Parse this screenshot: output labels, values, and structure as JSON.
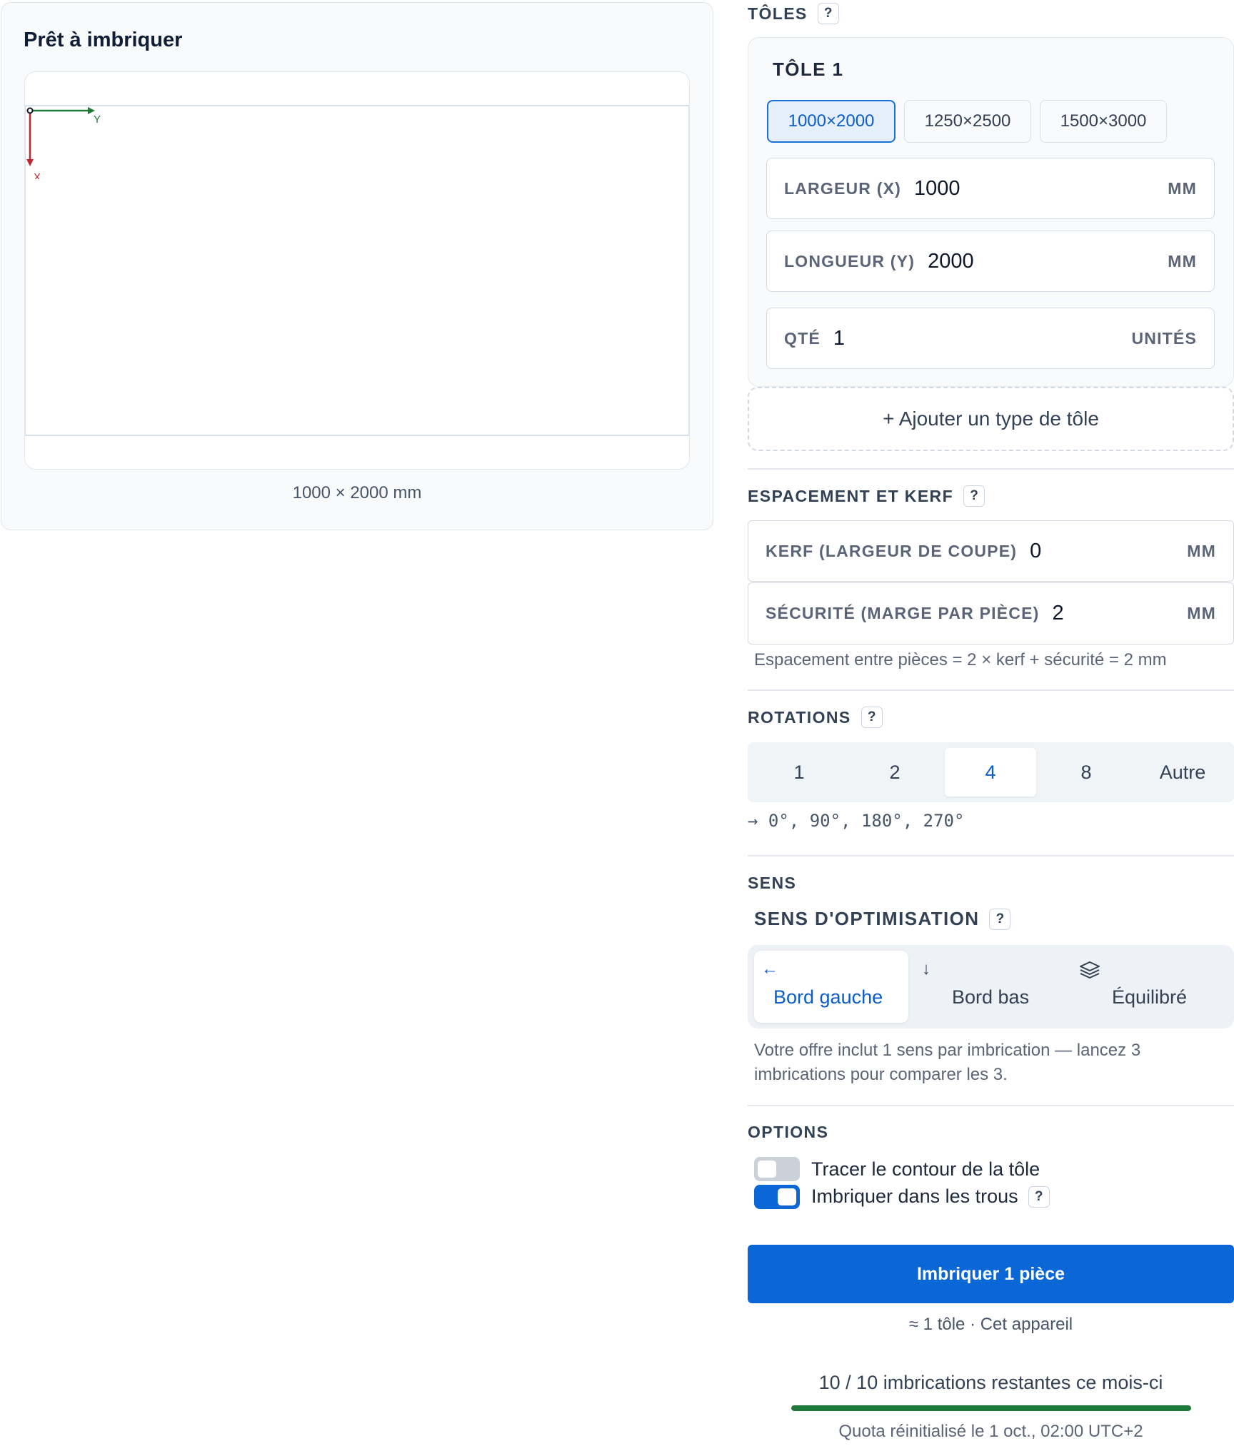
{
  "preview": {
    "title": "Prêt à imbriquer",
    "axis_x": "X",
    "axis_y": "Y",
    "dims": "1000 × 2000 mm"
  },
  "sheets": {
    "heading": "TÔLES",
    "help": "?",
    "card_title": "TÔLE 1",
    "presets": [
      "1000×2000",
      "1250×2500",
      "1500×3000"
    ],
    "active_preset": "1000×2000",
    "width": {
      "label": "LARGEUR (X)",
      "value": "1000",
      "unit": "MM"
    },
    "length": {
      "label": "LONGUEUR (Y)",
      "value": "2000",
      "unit": "MM"
    },
    "qty": {
      "label": "QTÉ",
      "value": "1",
      "unit": "UNITÉS"
    },
    "add_label": "+ Ajouter un type de tôle"
  },
  "spacing": {
    "heading": "ESPACEMENT ET KERF",
    "help": "?",
    "kerf": {
      "label": "KERF (LARGEUR DE COUPE)",
      "value": "0",
      "unit": "MM"
    },
    "safety": {
      "label": "SÉCURITÉ (MARGE PAR PIÈCE)",
      "value": "2",
      "unit": "MM"
    },
    "formula": "Espacement entre pièces = 2 × kerf + sécurité = 2 mm"
  },
  "rotations": {
    "heading": "ROTATIONS",
    "help": "?",
    "options": [
      "1",
      "2",
      "4",
      "8",
      "Autre"
    ],
    "active": "4",
    "note": "→ 0°, 90°, 180°, 270°"
  },
  "direction": {
    "heading": "SENS",
    "subheading": "SENS D'OPTIMISATION",
    "help": "?",
    "options": [
      {
        "label": "Bord gauche",
        "icon": "arrow-left-icon",
        "glyph": "←"
      },
      {
        "label": "Bord bas",
        "icon": "arrow-down-icon",
        "glyph": "↓"
      },
      {
        "label": "Équilibré",
        "icon": "layers-icon",
        "glyph": ""
      }
    ],
    "active": "Bord gauche",
    "note": "Votre offre inclut 1 sens par imbrication — lancez 3 imbrications pour comparer les 3."
  },
  "options": {
    "heading": "OPTIONS",
    "items": [
      {
        "label": "Tracer le contour de la tôle",
        "on": false
      },
      {
        "label": "Imbriquer dans les trous",
        "on": true,
        "help": "?"
      }
    ]
  },
  "action": {
    "button_label": "Imbriquer 1 pièce",
    "sub_label": "≈ 1 tôle · Cet appareil"
  },
  "quota": {
    "text": "10 / 10 imbrications restantes ce mois-ci",
    "remaining_fraction": 1.0,
    "reset": "Quota réinitialisé le 1 oct., 02:00 UTC+2"
  },
  "colors": {
    "accent": "#0b67d6",
    "quota_bar": "#1f7a3a",
    "axis_x": "#c0262d",
    "axis_y": "#1f7a3a"
  }
}
